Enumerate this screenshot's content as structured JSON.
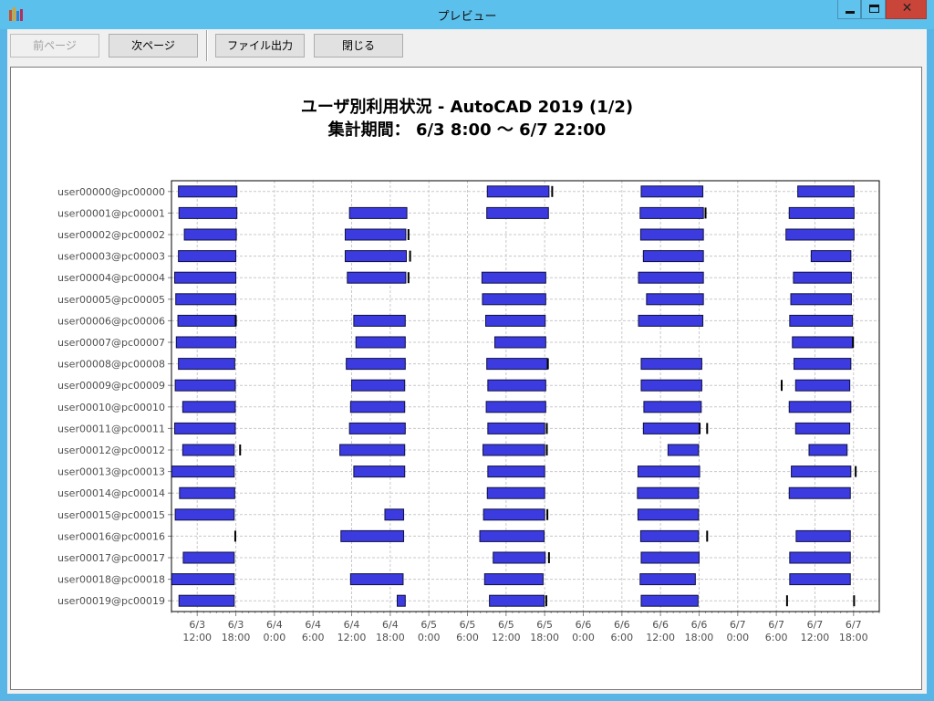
{
  "window": {
    "title": "プレビュー"
  },
  "toolbar": {
    "prev_label": "前ページ",
    "next_label": "次ページ",
    "export_label": "ファイル出力",
    "close_label": "閉じる"
  },
  "report": {
    "title": "ユーザ別利用状況 - AutoCAD 2019 (1/2)",
    "period": "集計期間： 6/3 8:00 ～ 6/7 22:00"
  },
  "colors": {
    "bar_fill": "#3b3be0",
    "bar_edge": "#101040",
    "grid": "#c8c8c8",
    "label": "#505050"
  },
  "chart_data": {
    "type": "gantt",
    "x_unit": "time",
    "x_axis": {
      "ticks": [
        {
          "date": "6/3",
          "time": "12:00"
        },
        {
          "date": "6/3",
          "time": "18:00"
        },
        {
          "date": "6/4",
          "time": "0:00"
        },
        {
          "date": "6/4",
          "time": "6:00"
        },
        {
          "date": "6/4",
          "time": "12:00"
        },
        {
          "date": "6/4",
          "time": "18:00"
        },
        {
          "date": "6/5",
          "time": "0:00"
        },
        {
          "date": "6/5",
          "time": "6:00"
        },
        {
          "date": "6/5",
          "time": "12:00"
        },
        {
          "date": "6/5",
          "time": "18:00"
        },
        {
          "date": "6/6",
          "time": "0:00"
        },
        {
          "date": "6/6",
          "time": "6:00"
        },
        {
          "date": "6/6",
          "time": "12:00"
        },
        {
          "date": "6/6",
          "time": "18:00"
        },
        {
          "date": "6/7",
          "time": "0:00"
        },
        {
          "date": "6/7",
          "time": "6:00"
        },
        {
          "date": "6/7",
          "time": "12:00"
        },
        {
          "date": "6/7",
          "time": "18:00"
        }
      ]
    },
    "grid": true,
    "rows": [
      {
        "label": "user00000@pc00000",
        "bars": [
          [
            "6/3 09:05",
            "6/3 18:10"
          ],
          [
            "6/5 09:05",
            "6/5 18:40"
          ],
          [
            "6/6 09:00",
            "6/6 18:35"
          ],
          [
            "6/7 09:20",
            "6/7 18:05"
          ]
        ],
        "marks": [
          "6/5 19:10"
        ]
      },
      {
        "label": "user00001@pc00001",
        "bars": [
          [
            "6/3 09:10",
            "6/3 18:10"
          ],
          [
            "6/4 11:40",
            "6/4 20:35"
          ],
          [
            "6/5 09:00",
            "6/5 18:35"
          ],
          [
            "6/6 08:50",
            "6/6 18:40"
          ],
          [
            "6/7 08:00",
            "6/7 18:05"
          ]
        ],
        "marks": [
          "6/6 19:00"
        ]
      },
      {
        "label": "user00002@pc00002",
        "bars": [
          [
            "6/3 10:00",
            "6/3 18:05"
          ],
          [
            "6/4 11:00",
            "6/4 20:25"
          ],
          [
            "6/6 08:55",
            "6/6 18:40"
          ],
          [
            "6/7 07:30",
            "6/7 18:05"
          ]
        ],
        "marks": [
          "6/4 20:50"
        ]
      },
      {
        "label": "user00003@pc00003",
        "bars": [
          [
            "6/3 09:05",
            "6/3 18:00"
          ],
          [
            "6/4 11:00",
            "6/4 20:30"
          ],
          [
            "6/6 09:20",
            "6/6 18:40"
          ],
          [
            "6/7 11:25",
            "6/7 17:35"
          ]
        ],
        "marks": [
          "6/4 21:05"
        ]
      },
      {
        "label": "user00004@pc00004",
        "bars": [
          [
            "6/3 08:30",
            "6/3 18:00"
          ],
          [
            "6/4 11:20",
            "6/4 20:25"
          ],
          [
            "6/5 08:15",
            "6/5 18:10"
          ],
          [
            "6/6 08:35",
            "6/6 18:40"
          ],
          [
            "6/7 08:40",
            "6/7 17:40"
          ]
        ],
        "marks": [
          "6/4 20:50"
        ]
      },
      {
        "label": "user00005@pc00005",
        "bars": [
          [
            "6/3 08:40",
            "6/3 18:00"
          ],
          [
            "6/5 08:20",
            "6/5 18:10"
          ],
          [
            "6/6 09:50",
            "6/6 18:40"
          ],
          [
            "6/7 08:15",
            "6/7 17:40"
          ]
        ],
        "marks": []
      },
      {
        "label": "user00006@pc00006",
        "bars": [
          [
            "6/3 09:00",
            "6/3 18:00"
          ],
          [
            "6/4 12:20",
            "6/4 20:20"
          ],
          [
            "6/5 08:50",
            "6/5 18:05"
          ],
          [
            "6/6 08:35",
            "6/6 18:35"
          ],
          [
            "6/7 08:05",
            "6/7 17:50"
          ]
        ],
        "marks": [
          "6/3 18:00"
        ]
      },
      {
        "label": "user00007@pc00007",
        "bars": [
          [
            "6/3 08:45",
            "6/3 18:00"
          ],
          [
            "6/4 12:40",
            "6/4 20:20"
          ],
          [
            "6/5 10:15",
            "6/5 18:10"
          ],
          [
            "6/7 08:30",
            "6/7 17:55"
          ]
        ],
        "marks": [
          "6/7 17:55"
        ]
      },
      {
        "label": "user00008@pc00008",
        "bars": [
          [
            "6/3 09:05",
            "6/3 17:50"
          ],
          [
            "6/4 11:10",
            "6/4 20:20"
          ],
          [
            "6/5 09:00",
            "6/5 18:25"
          ],
          [
            "6/6 09:00",
            "6/6 18:25"
          ],
          [
            "6/7 08:45",
            "6/7 17:35"
          ]
        ],
        "marks": [
          "6/5 18:30"
        ]
      },
      {
        "label": "user00009@pc00009",
        "bars": [
          [
            "6/3 08:35",
            "6/3 17:55"
          ],
          [
            "6/4 12:00",
            "6/4 20:15"
          ],
          [
            "6/5 09:10",
            "6/5 18:10"
          ],
          [
            "6/6 09:00",
            "6/6 18:25"
          ],
          [
            "6/7 09:00",
            "6/7 17:25"
          ]
        ],
        "marks": [
          "6/7 06:50"
        ]
      },
      {
        "label": "user00010@pc00010",
        "bars": [
          [
            "6/3 09:45",
            "6/3 17:55"
          ],
          [
            "6/4 11:50",
            "6/4 20:15"
          ],
          [
            "6/5 08:55",
            "6/5 18:10"
          ],
          [
            "6/6 09:25",
            "6/6 18:20"
          ],
          [
            "6/7 08:00",
            "6/7 17:35"
          ]
        ],
        "marks": []
      },
      {
        "label": "user00011@pc00011",
        "bars": [
          [
            "6/3 08:30",
            "6/3 17:55"
          ],
          [
            "6/4 11:40",
            "6/4 20:20"
          ],
          [
            "6/5 09:10",
            "6/5 18:00"
          ],
          [
            "6/6 09:20",
            "6/6 18:05"
          ],
          [
            "6/7 09:00",
            "6/7 17:25"
          ]
        ],
        "marks": [
          "6/5 18:20",
          "6/6 18:05",
          "6/6 19:15"
        ]
      },
      {
        "label": "user00012@pc00012",
        "bars": [
          [
            "6/3 09:45",
            "6/3 17:45"
          ],
          [
            "6/4 10:10",
            "6/4 20:15"
          ],
          [
            "6/5 08:25",
            "6/5 18:00"
          ],
          [
            "6/6 13:10",
            "6/6 17:55"
          ],
          [
            "6/7 11:05",
            "6/7 17:00"
          ]
        ],
        "marks": [
          "6/3 18:40",
          "6/5 18:20"
        ]
      },
      {
        "label": "user00013@pc00013",
        "bars": [
          [
            "6/3 08:00",
            "6/3 17:45"
          ],
          [
            "6/4 12:20",
            "6/4 20:15"
          ],
          [
            "6/5 09:10",
            "6/5 18:00"
          ],
          [
            "6/6 08:30",
            "6/6 18:05"
          ],
          [
            "6/7 08:20",
            "6/7 17:35"
          ]
        ],
        "marks": [
          "6/7 18:20"
        ]
      },
      {
        "label": "user00014@pc00014",
        "bars": [
          [
            "6/3 09:15",
            "6/3 17:50"
          ],
          [
            "6/5 09:05",
            "6/5 18:00"
          ],
          [
            "6/6 08:25",
            "6/6 17:55"
          ],
          [
            "6/7 08:00",
            "6/7 17:30"
          ]
        ],
        "marks": []
      },
      {
        "label": "user00015@pc00015",
        "bars": [
          [
            "6/3 08:35",
            "6/3 17:45"
          ],
          [
            "6/4 17:10",
            "6/4 20:05"
          ],
          [
            "6/5 08:30",
            "6/5 18:00"
          ],
          [
            "6/6 08:30",
            "6/6 17:55"
          ]
        ],
        "marks": [
          "6/5 18:25"
        ]
      },
      {
        "label": "user00016@pc00016",
        "bars": [
          [
            "6/4 10:20",
            "6/4 20:05"
          ],
          [
            "6/5 07:55",
            "6/5 17:55"
          ],
          [
            "6/6 08:55",
            "6/6 17:55"
          ],
          [
            "6/7 09:05",
            "6/7 17:30"
          ]
        ],
        "marks": [
          "6/3 17:55",
          "6/6 19:15"
        ]
      },
      {
        "label": "user00017@pc00017",
        "bars": [
          [
            "6/3 09:50",
            "6/3 17:45"
          ],
          [
            "6/5 10:00",
            "6/5 18:05"
          ],
          [
            "6/6 09:00",
            "6/6 18:00"
          ],
          [
            "6/7 08:05",
            "6/7 17:30"
          ]
        ],
        "marks": [
          "6/5 18:40"
        ]
      },
      {
        "label": "user00018@pc00018",
        "bars": [
          [
            "6/3 08:00",
            "6/3 17:45"
          ],
          [
            "6/4 11:50",
            "6/4 20:00"
          ],
          [
            "6/5 08:40",
            "6/5 17:45"
          ],
          [
            "6/6 08:50",
            "6/6 17:25"
          ],
          [
            "6/7 08:05",
            "6/7 17:30"
          ]
        ],
        "marks": []
      },
      {
        "label": "user00019@pc00019",
        "bars": [
          [
            "6/3 09:10",
            "6/3 17:45"
          ],
          [
            "6/4 19:05",
            "6/4 20:20"
          ],
          [
            "6/5 09:25",
            "6/5 17:55"
          ],
          [
            "6/6 09:00",
            "6/6 17:50"
          ]
        ],
        "marks": [
          "6/5 18:15",
          "6/7 07:40",
          "6/7 18:05"
        ]
      }
    ]
  }
}
